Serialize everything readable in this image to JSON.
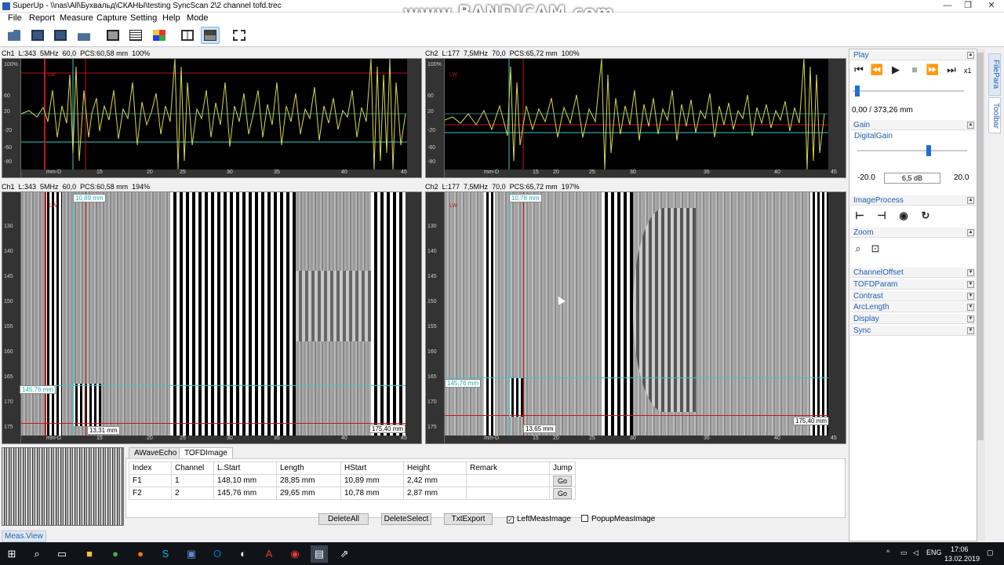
{
  "window": {
    "title": "SuperUp - \\\\nas\\All\\Бухвальд\\СКАНЫ\\testing SyncScan 2\\2 channel tofd.trec",
    "minimize_glyph": "—",
    "maximize_glyph": "❐",
    "close_glyph": "✕"
  },
  "watermark": "www.BANDICAM.com",
  "menu": [
    "File",
    "Report",
    "Measure",
    "Capture",
    "Setting",
    "Help",
    "Mode"
  ],
  "toolbar_icons": [
    "open-folder-icon",
    "save-icon",
    "save-as-icon",
    "export-icon",
    "camera-icon",
    "report-icon",
    "palette-icon",
    "split-view-icon",
    "layout-icon",
    "crop-icon"
  ],
  "panes": {
    "ch1_ascan": {
      "channel": "Ch1",
      "l": "L:343",
      "freq": "5MHz",
      "angle": "60,0",
      "pcs": "PCS:60,58 mm",
      "zoom": "100%",
      "lw": "LW"
    },
    "ch2_ascan": {
      "channel": "Ch2",
      "l": "L:177",
      "freq": "7,5MHz",
      "angle": "70,0",
      "pcs": "PCS:65,72 mm",
      "zoom": "100%",
      "lw": "LW"
    },
    "ch1_tofd": {
      "channel": "Ch1",
      "l": "L:343",
      "freq": "5MHz",
      "angle": "60,0",
      "pcs": "PCS:60,58 mm",
      "zoom": "194%",
      "lw": "LW",
      "h_label": "10,89 mm",
      "pos_label": "145,76 mm",
      "bottom_label": "13,31 mm",
      "end_label": "175,40 mm"
    },
    "ch2_tofd": {
      "channel": "Ch2",
      "l": "L:177",
      "freq": "7,5MHz",
      "angle": "70,0",
      "pcs": "PCS:65,72 mm",
      "zoom": "197%",
      "lw": "LW",
      "h_label": "10,78 mm",
      "pos_label": "145,76 mm",
      "bottom_label": "13,65 mm",
      "end_label": "175,40 mm"
    }
  },
  "axis": {
    "x_ticks": [
      "15",
      "20",
      "25",
      "30",
      "35",
      "40",
      "45"
    ],
    "x_unit": "mm-D",
    "ascan_y_ticks": [
      "100%",
      "60",
      "20",
      "-20",
      "-60",
      "-80"
    ],
    "tofd_y_ticks": [
      "130",
      "140",
      "145",
      "150",
      "155",
      "160",
      "165",
      "170",
      "175"
    ]
  },
  "right_panel": {
    "play": {
      "title": "Play",
      "speed": "x1",
      "position": "0,00 / 373,26 mm",
      "progress": 0.02
    },
    "gain": {
      "title": "Gain",
      "subtitle": "DigitalGain",
      "min": "-20.0",
      "max": "20.0",
      "value": "6,5 dB",
      "level": 0.66
    },
    "image_process": {
      "title": "ImageProcess"
    },
    "zoom": {
      "title": "Zoom"
    },
    "collapsed": [
      "ChannelOffset",
      "TOFDParam",
      "Contrast",
      "ArcLength",
      "Display",
      "Sync"
    ]
  },
  "side_tabs": [
    "FilePara",
    "Toolbar"
  ],
  "bottom": {
    "tabs": [
      "AWaveEcho",
      "TOFDImage"
    ],
    "selected_tab": "TOFDImage",
    "columns": [
      "Index",
      "Channel",
      "L.Start",
      "Length",
      "HStart",
      "Height",
      "Remark",
      "Jump"
    ],
    "rows": [
      {
        "index": "F1",
        "channel": "1",
        "lstart": "148,10 mm",
        "length": "28,85 mm",
        "hstart": "10,89 mm",
        "height": "2,42 mm",
        "remark": "",
        "jump": "Go"
      },
      {
        "index": "F2",
        "channel": "2",
        "lstart": "145,76 mm",
        "length": "29,65 mm",
        "hstart": "10,78 mm",
        "height": "2,87 mm",
        "remark": "",
        "jump": "Go"
      }
    ],
    "buttons": {
      "delete_all": "DeleteAll",
      "delete_select": "DeleteSelect",
      "txt_export": "TxtExport"
    },
    "checks": {
      "left_meas": "LeftMeasImage",
      "left_meas_checked": true,
      "popup_meas": "PopupMeasImage",
      "popup_meas_checked": false
    }
  },
  "status": {
    "meas_view": "Meas.View"
  },
  "taskbar": {
    "lang": "ENG",
    "time": "17:06",
    "date": "13.02.2019"
  },
  "colors": {
    "echo": "#d8d850",
    "cyan": "#3cc8c8",
    "red": "#c01818",
    "accent": "#1f5fb2"
  }
}
